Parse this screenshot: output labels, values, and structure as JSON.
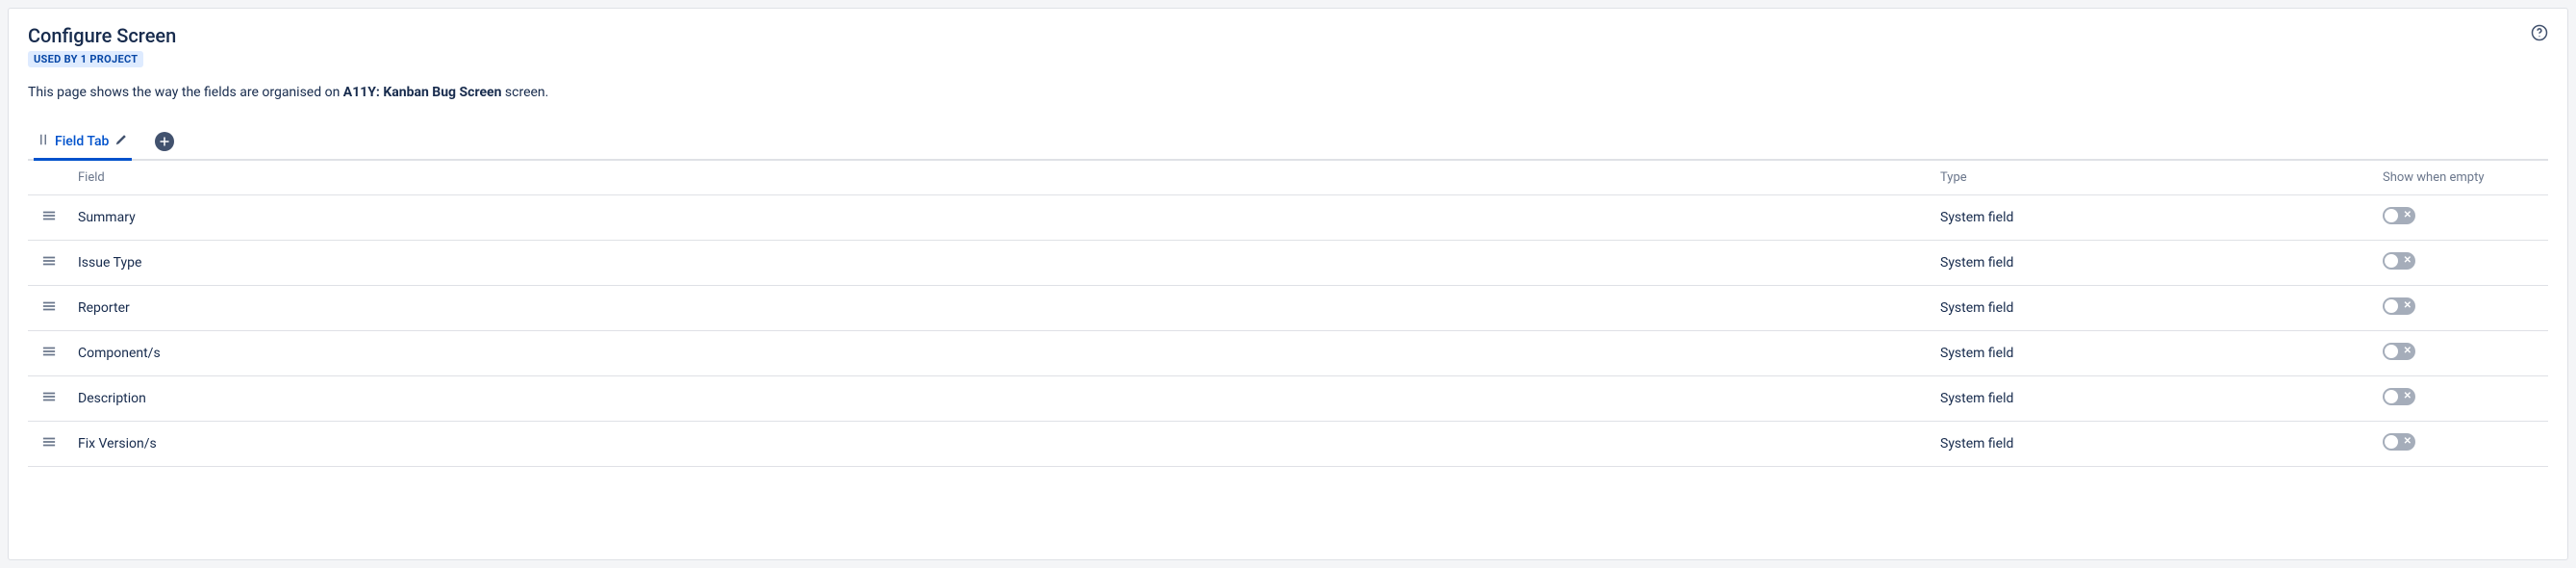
{
  "header": {
    "title": "Configure Screen",
    "badge": "USED BY 1 PROJECT"
  },
  "description": {
    "prefix": "This page shows the way the fields are organised on ",
    "screen_name": "A11Y: Kanban Bug Screen",
    "suffix": " screen."
  },
  "tabs": {
    "active_label": "Field Tab"
  },
  "table": {
    "headers": {
      "field": "Field",
      "type": "Type",
      "show_when_empty": "Show when empty"
    },
    "rows": [
      {
        "field": "Summary",
        "type": "System field"
      },
      {
        "field": "Issue Type",
        "type": "System field"
      },
      {
        "field": "Reporter",
        "type": "System field"
      },
      {
        "field": "Component/s",
        "type": "System field"
      },
      {
        "field": "Description",
        "type": "System field"
      },
      {
        "field": "Fix Version/s",
        "type": "System field"
      }
    ]
  }
}
